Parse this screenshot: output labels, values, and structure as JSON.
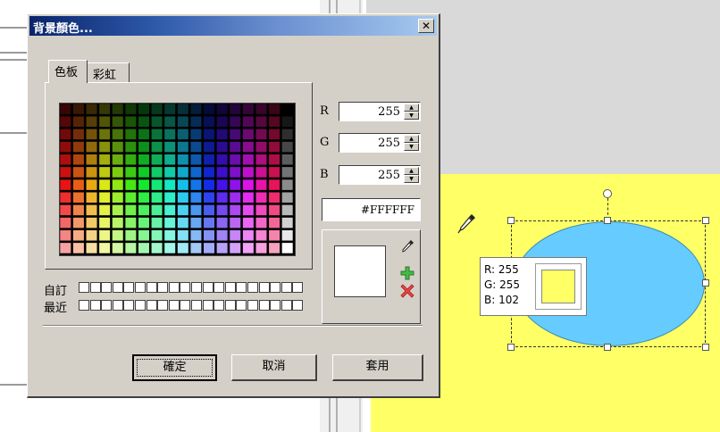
{
  "dialog": {
    "title": "背景顏色...",
    "close_glyph": "✕",
    "tabs": [
      {
        "label": "色板",
        "active": true
      },
      {
        "label": "彩虹",
        "active": false
      }
    ],
    "custom_label": "自訂",
    "recent_label": "最近",
    "rgb": {
      "r_label": "R",
      "r_value": "255",
      "g_label": "G",
      "g_value": "255",
      "b_label": "B",
      "b_value": "255"
    },
    "hex_value": "#FFFFFF",
    "preview_color": "#FFFFFF",
    "tools": [
      {
        "name": "eyedropper-icon"
      },
      {
        "name": "add-color-icon",
        "color": "#33aa33"
      },
      {
        "name": "remove-color-icon",
        "color": "#e03030"
      }
    ],
    "buttons": {
      "ok": "確定",
      "cancel": "取消",
      "apply": "套用"
    }
  },
  "canvas": {
    "background_color": "#FFFF66",
    "shape_color": "#66CCFF",
    "tooltip": {
      "r": "R: 255",
      "g": "G: 255",
      "b": "B: 102",
      "swatch_color": "#FFFF66"
    }
  }
}
